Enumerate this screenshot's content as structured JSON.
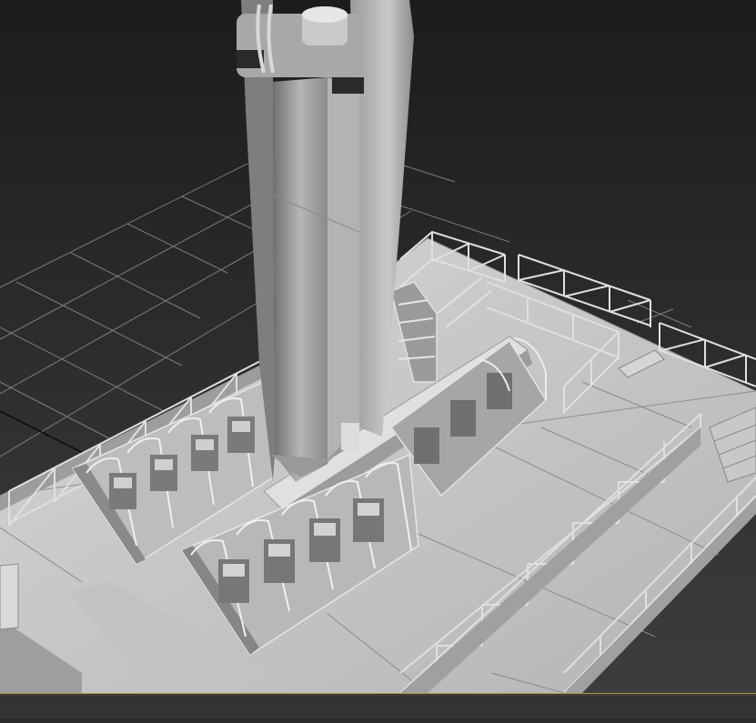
{
  "app": {
    "view": "perspective-viewport",
    "colors": {
      "background_top": "#1c1c1c",
      "background_bottom": "#3a3a3a",
      "grid_line": "#7a7a7a",
      "grid_axis": "#0a0a0a",
      "model_light": "#cfcfcf",
      "model_mid": "#a4a4a4",
      "model_dark": "#6e6e6e",
      "timeline_bg": "#3a3a3a",
      "timeline_accent": "#b89538"
    }
  },
  "viewport": {
    "shading": "default-shading",
    "grid": true,
    "model": "amusement-ride-tower-station"
  },
  "timeline": {
    "visible": true
  }
}
